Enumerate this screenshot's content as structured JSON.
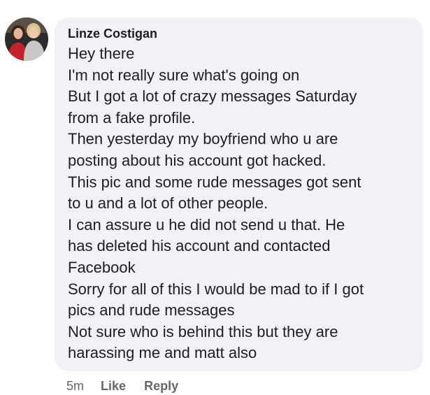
{
  "comment": {
    "author": "Linze Costigan",
    "lines": [
      "Hey there",
      "I'm not really sure what's going on",
      "But I got a lot of crazy messages Saturday",
      "from a fake profile.",
      "Then yesterday my boyfriend who u are",
      "posting about his account got hacked.",
      "This pic and some rude messages got sent",
      "to u and a lot of other people.",
      "I can assure u he did not send u that. He",
      "has deleted his account and contacted",
      "Facebook",
      "Sorry for all of this I would be mad to if I got",
      "pics and rude messages",
      "Not sure who is behind this but they are",
      "harassing me and matt also"
    ],
    "timestamp": "5m",
    "like_label": "Like",
    "reply_label": "Reply"
  },
  "colors": {
    "bubble_bg": "#f0f2f5",
    "text": "#1c1e21",
    "meta_text": "#65676b"
  },
  "icons": {
    "avatar": "profile-photo"
  }
}
